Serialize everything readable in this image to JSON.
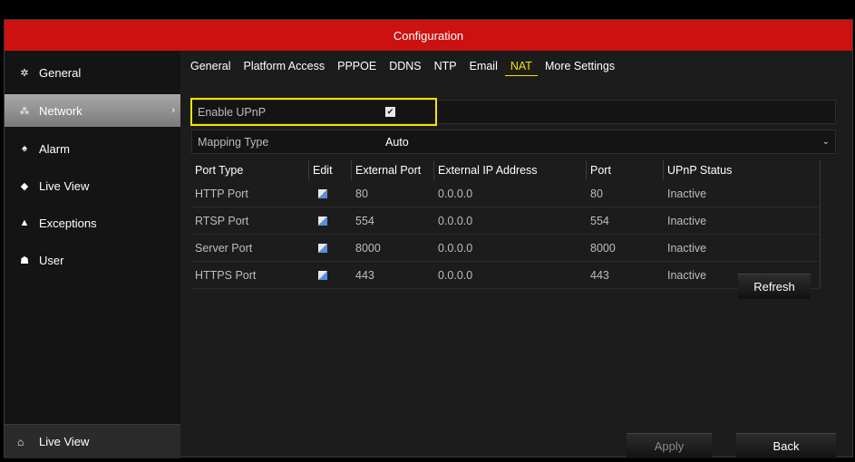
{
  "window": {
    "title": "Configuration"
  },
  "sidebar": {
    "items": [
      {
        "label": "General",
        "icon": "gear-icon"
      },
      {
        "label": "Network",
        "icon": "network-icon"
      },
      {
        "label": "Alarm",
        "icon": "alarm-icon"
      },
      {
        "label": "Live View",
        "icon": "eye-icon"
      },
      {
        "label": "Exceptions",
        "icon": "warning-icon"
      },
      {
        "label": "User",
        "icon": "user-icon"
      }
    ],
    "active_index": 1,
    "bottom": {
      "label": "Live View",
      "icon": "home-icon"
    }
  },
  "tabs": [
    {
      "label": "General"
    },
    {
      "label": "Platform Access"
    },
    {
      "label": "PPPOE"
    },
    {
      "label": "DDNS"
    },
    {
      "label": "NTP"
    },
    {
      "label": "Email"
    },
    {
      "label": "NAT"
    },
    {
      "label": "More Settings"
    }
  ],
  "active_tab": "NAT",
  "form": {
    "enable_upnp_label": "Enable UPnP",
    "enable_upnp_checked": true,
    "mapping_type_label": "Mapping Type",
    "mapping_type_value": "Auto"
  },
  "table": {
    "headers": [
      "Port Type",
      "Edit",
      "External Port",
      "External IP Address",
      "Port",
      "UPnP Status"
    ],
    "rows": [
      {
        "port_type": "HTTP Port",
        "external_port": "80",
        "external_ip": "0.0.0.0",
        "port": "80",
        "status": "Inactive"
      },
      {
        "port_type": "RTSP Port",
        "external_port": "554",
        "external_ip": "0.0.0.0",
        "port": "554",
        "status": "Inactive"
      },
      {
        "port_type": "Server Port",
        "external_port": "8000",
        "external_ip": "0.0.0.0",
        "port": "8000",
        "status": "Inactive"
      },
      {
        "port_type": "HTTPS Port",
        "external_port": "443",
        "external_ip": "0.0.0.0",
        "port": "443",
        "status": "Inactive"
      }
    ]
  },
  "buttons": {
    "refresh": "Refresh",
    "apply": "Apply",
    "back": "Back"
  },
  "colors": {
    "titlebar": "#cc1111",
    "highlight": "#f5e400",
    "active_tab": "#f5e400"
  }
}
